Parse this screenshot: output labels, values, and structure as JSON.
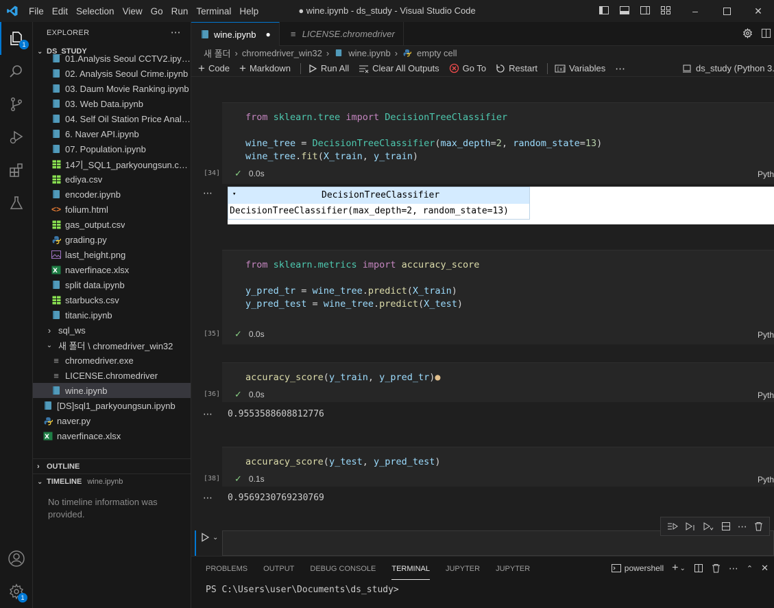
{
  "window": {
    "title": "● wine.ipynb - ds_study - Visual Studio Code",
    "menu": [
      "File",
      "Edit",
      "Selection",
      "View",
      "Go",
      "Run",
      "Terminal",
      "Help"
    ]
  },
  "activity_bar": {
    "explorer_badge": "1",
    "settings_badge": "1"
  },
  "sidebar": {
    "header": "EXPLORER",
    "root": "DS_STUDY",
    "items": [
      {
        "label": "01.Analysis Seoul CCTV2.ipynb",
        "type": "ipynb",
        "indent": 1
      },
      {
        "label": "02. Analysis Seoul Crime.ipynb",
        "type": "ipynb",
        "indent": 1
      },
      {
        "label": "03. Daum Movie Ranking.ipynb",
        "type": "ipynb",
        "indent": 1
      },
      {
        "label": "03. Web Data.ipynb",
        "type": "ipynb",
        "indent": 1
      },
      {
        "label": "04. Self Oil Station Price Analys...",
        "type": "ipynb",
        "indent": 1
      },
      {
        "label": "6. Naver API.ipynb",
        "type": "ipynb",
        "indent": 1
      },
      {
        "label": "07. Population.ipynb",
        "type": "ipynb",
        "indent": 1
      },
      {
        "label": "14기_SQL1_parkyoungsun.csv.c...",
        "type": "csv",
        "indent": 1
      },
      {
        "label": "ediya.csv",
        "type": "csv",
        "indent": 1
      },
      {
        "label": "encoder.ipynb",
        "type": "ipynb",
        "indent": 1
      },
      {
        "label": "folium.html",
        "type": "html",
        "indent": 1
      },
      {
        "label": "gas_output.csv",
        "type": "csv",
        "indent": 1
      },
      {
        "label": "grading.py",
        "type": "py",
        "indent": 1
      },
      {
        "label": "last_height.png",
        "type": "png",
        "indent": 1
      },
      {
        "label": "naverfinace.xlsx",
        "type": "xlsx",
        "indent": 1
      },
      {
        "label": "split data.ipynb",
        "type": "ipynb",
        "indent": 1
      },
      {
        "label": "starbucks.csv",
        "type": "csv",
        "indent": 1
      },
      {
        "label": "titanic.ipynb",
        "type": "ipynb",
        "indent": 1
      },
      {
        "label": "sql_ws",
        "type": "folder-closed",
        "indent": 0
      },
      {
        "label": "새 폴더 \\ chromedriver_win32",
        "type": "folder-open",
        "indent": 0
      },
      {
        "label": "chromedriver.exe",
        "type": "txt",
        "indent": 1
      },
      {
        "label": "LICENSE.chromedriver",
        "type": "txt",
        "indent": 1
      },
      {
        "label": "wine.ipynb",
        "type": "ipynb",
        "indent": 1,
        "selected": true
      },
      {
        "label": "[DS]sql1_parkyoungsun.ipynb",
        "type": "ipynb",
        "indent": 0
      },
      {
        "label": "naver.py",
        "type": "py",
        "indent": 0
      },
      {
        "label": "naverfinace.xlsx",
        "type": "xlsx",
        "indent": 0
      }
    ],
    "outline": "OUTLINE",
    "timeline": "TIMELINE",
    "timeline_file": "wine.ipynb",
    "timeline_empty": "No timeline information was provided."
  },
  "tabs": [
    {
      "label": "wine.ipynb",
      "active": true
    },
    {
      "label": "LICENSE.chromedriver",
      "active": false
    }
  ],
  "breadcrumb": [
    "새 폴더",
    "chromedriver_win32",
    "wine.ipynb",
    "empty cell"
  ],
  "toolbar": {
    "code": "Code",
    "markdown": "Markdown",
    "run_all": "Run All",
    "clear_all": "Clear All Outputs",
    "goto": "Go To",
    "restart": "Restart",
    "variables": "Variables",
    "kernel": "ds_study (Python 3.8"
  },
  "cells": [
    {
      "exec": "[34]",
      "time": "0.0s",
      "lang": "Pyth",
      "line1": {
        "kw1": "from",
        "mod": "sklearn.tree",
        "kw2": "import",
        "cls": "DecisionTreeClassifier"
      },
      "line3": {
        "var": "wine_tree",
        "eq": " = ",
        "cls": "DecisionTreeClassifier",
        "args": "max_depth",
        "n1": "2",
        "args2": "random_state",
        "n2": "13"
      },
      "line4": {
        "var": "wine_tree",
        "fn": "fit",
        "a1": "X_train",
        "a2": "y_train"
      },
      "output_title": "DecisionTreeClassifier",
      "output_repr": "DecisionTreeClassifier(max_depth=2, random_state=13)"
    },
    {
      "exec": "[35]",
      "time": "0.0s",
      "lang": "Pyth",
      "line1": {
        "kw1": "from",
        "mod": "sklearn.metrics",
        "kw2": "import",
        "fn": "accuracy_score"
      },
      "line3": {
        "var": "y_pred_tr",
        "obj": "wine_tree",
        "fn": "predict",
        "arg": "X_train"
      },
      "line4": {
        "var": "y_pred_test",
        "obj": "wine_tree",
        "fn": "predict",
        "arg": "X_test"
      }
    },
    {
      "exec": "[36]",
      "time": "0.0s",
      "lang": "Pyth",
      "fn": "accuracy_score",
      "a1": "y_train",
      "a2": "y_pred_tr",
      "output": "0.9553588608812776"
    },
    {
      "exec": "[38]",
      "time": "0.1s",
      "lang": "Pyth",
      "fn": "accuracy_score",
      "a1": "y_test",
      "a2": "y_pred_test",
      "output": "0.9569230769230769"
    }
  ],
  "panel": {
    "tabs": [
      "PROBLEMS",
      "OUTPUT",
      "DEBUG CONSOLE",
      "TERMINAL",
      "JUPYTER",
      "JUPYTER"
    ],
    "active_tab": "TERMINAL",
    "shell": "powershell",
    "prompt": "PS C:\\Users\\user\\Documents\\ds_study>"
  },
  "colors": {
    "accent": "#0078d4",
    "success": "#89d185"
  }
}
